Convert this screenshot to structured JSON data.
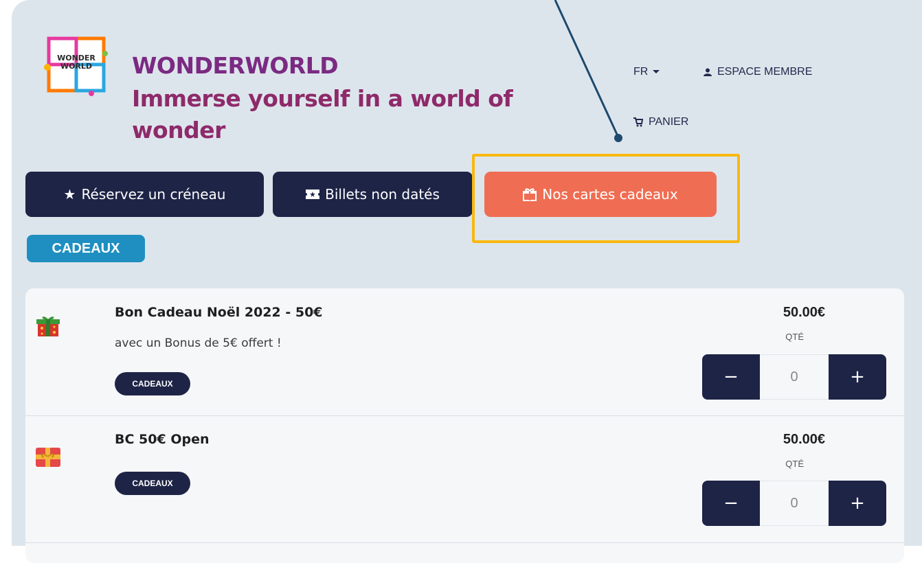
{
  "header": {
    "logo_text": "WONDER WORLD",
    "brand_name": "WONDERWORLD",
    "tagline": "Immerse yourself in a world of wonder",
    "language": "FR",
    "member_link": "ESPACE MEMBRE",
    "cart_link": "PANIER"
  },
  "nav": {
    "reserve": "Réservez un créneau",
    "tickets": "Billets non datés",
    "gift_cards": "Nos cartes cadeaux"
  },
  "category_filter": "CADEAUX",
  "products": [
    {
      "title": "Bon Cadeau Noël 2022 - 50€",
      "description": "avec un Bonus de 5€ offert !",
      "tag": "CADEAUX",
      "price": "50.00€",
      "qty_label": "QTÉ",
      "quantity": "0",
      "minus": "−",
      "plus": "+",
      "icon": "gift-box-icon"
    },
    {
      "title": "BC 50€ Open",
      "description": "",
      "tag": "CADEAUX",
      "price": "50.00€",
      "qty_label": "QTÉ",
      "quantity": "0",
      "minus": "−",
      "plus": "+",
      "icon": "gift-card-icon"
    }
  ],
  "colors": {
    "navy": "#1e2446",
    "coral": "#ef6d52",
    "highlight": "#f9b80f",
    "pill_blue": "#1e8fc0",
    "brand_purple": "#7b2a82"
  }
}
